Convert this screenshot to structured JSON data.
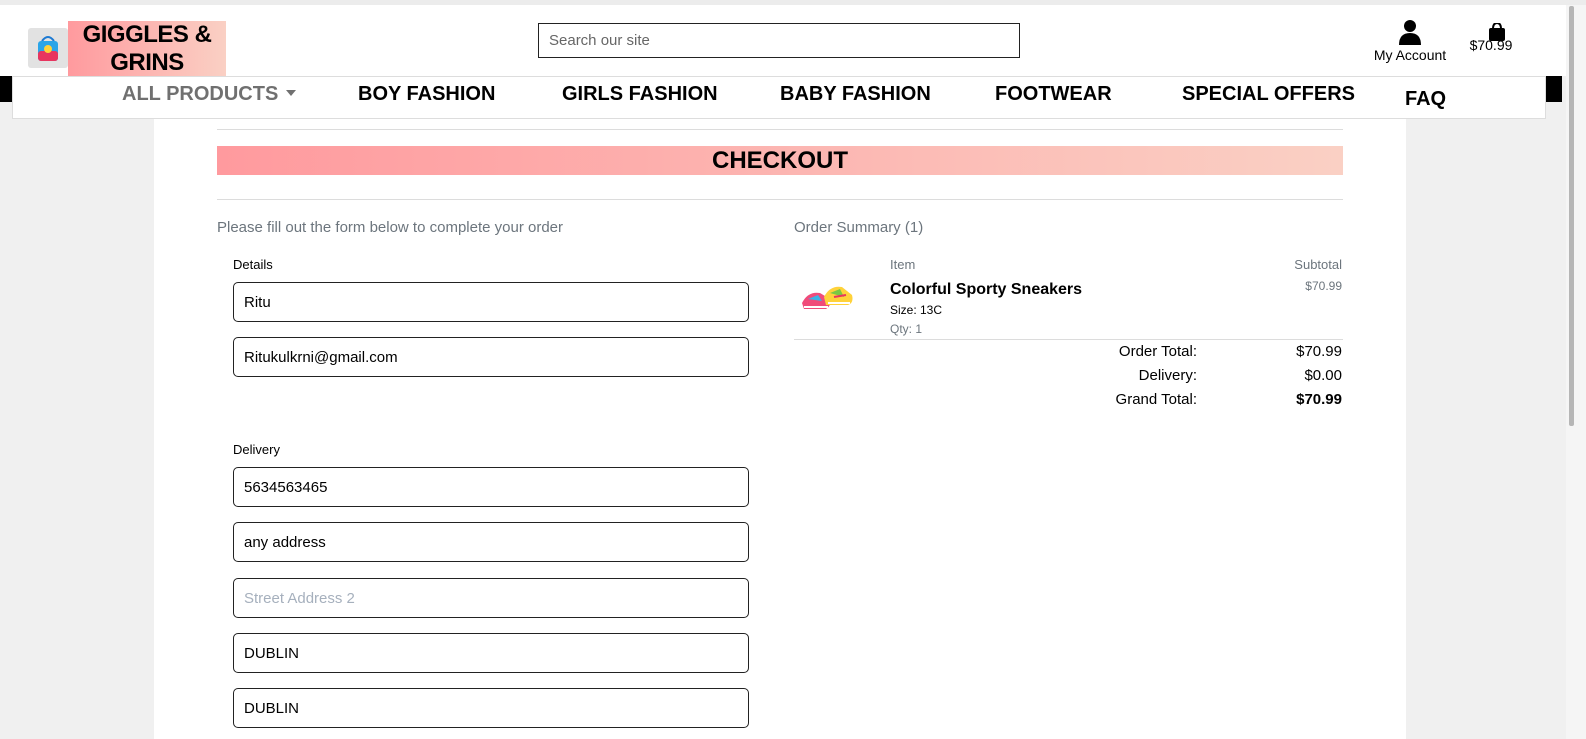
{
  "header": {
    "brand": "GIGGLES &\nGRINS",
    "search_placeholder": "Search our site",
    "account_label": "My Account",
    "cart_total": "$70.99"
  },
  "nav": {
    "items": [
      {
        "label": "ALL PRODUCTS",
        "has_dropdown": true
      },
      {
        "label": "BOY FASHION"
      },
      {
        "label": "GIRLS FASHION"
      },
      {
        "label": "BABY FASHION"
      },
      {
        "label": "FOOTWEAR"
      },
      {
        "label": "SPECIAL OFFERS"
      },
      {
        "label": "FAQ"
      }
    ]
  },
  "checkout": {
    "title": "CHECKOUT",
    "instructions": "Please fill out the form below to complete your order",
    "details_legend": "Details",
    "delivery_legend": "Delivery",
    "fields": {
      "full_name": {
        "value": "Ritu",
        "placeholder": ""
      },
      "email": {
        "value": "Ritukulkrni@gmail.com",
        "placeholder": ""
      },
      "phone": {
        "value": "5634563465",
        "placeholder": ""
      },
      "street1": {
        "value": "any address",
        "placeholder": ""
      },
      "street2": {
        "value": "",
        "placeholder": "Street Address 2"
      },
      "town": {
        "value": "DUBLIN",
        "placeholder": ""
      },
      "county": {
        "value": "DUBLIN",
        "placeholder": ""
      }
    }
  },
  "summary": {
    "title": "Order Summary (1)",
    "col_item": "Item",
    "col_subtotal": "Subtotal",
    "product": {
      "name": "Colorful Sporty Sneakers",
      "size": "Size: 13C",
      "qty": "Qty: 1",
      "subtotal": "$70.99"
    },
    "totals": {
      "order_total_label": "Order Total:",
      "order_total": "$70.99",
      "delivery_label": "Delivery:",
      "delivery": "$0.00",
      "grand_total_label": "Grand Total:",
      "grand_total": "$70.99"
    }
  },
  "colors": {
    "banner_start": "#ff9a9e",
    "banner_end": "#fad0c4",
    "muted": "#6c757d"
  }
}
